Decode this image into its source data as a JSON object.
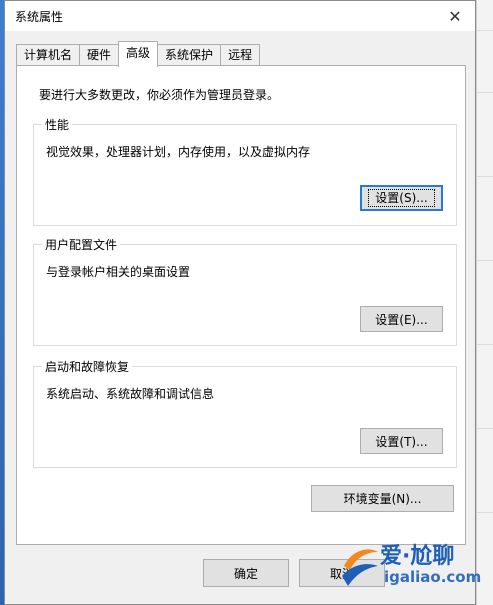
{
  "window": {
    "title": "系统属性",
    "close_glyph": "✕"
  },
  "tabs": [
    {
      "label": "计算机名"
    },
    {
      "label": "硬件"
    },
    {
      "label": "高级",
      "active": true
    },
    {
      "label": "系统保护"
    },
    {
      "label": "远程"
    }
  ],
  "advanced": {
    "admin_note": "要进行大多数更改，你必须作为管理员登录。",
    "performance": {
      "title": "性能",
      "description": "视觉效果，处理器计划，内存使用，以及虚拟内存",
      "button": "设置(S)..."
    },
    "user_profiles": {
      "title": "用户配置文件",
      "description": "与登录帐户相关的桌面设置",
      "button": "设置(E)..."
    },
    "startup_recovery": {
      "title": "启动和故障恢复",
      "description": "系统启动、系统故障和调试信息",
      "button": "设置(T)..."
    },
    "env_button": "环境变量(N)..."
  },
  "footer": {
    "ok": "确定",
    "cancel": "取消"
  },
  "watermark": {
    "text": "爱·尬聊",
    "url": "igaliao.com"
  },
  "colors": {
    "dialog_bg": "#f0f0f0",
    "page_bg": "#ffffff",
    "accent": "#2a7ad5",
    "watermark": "#1f5fb8"
  }
}
